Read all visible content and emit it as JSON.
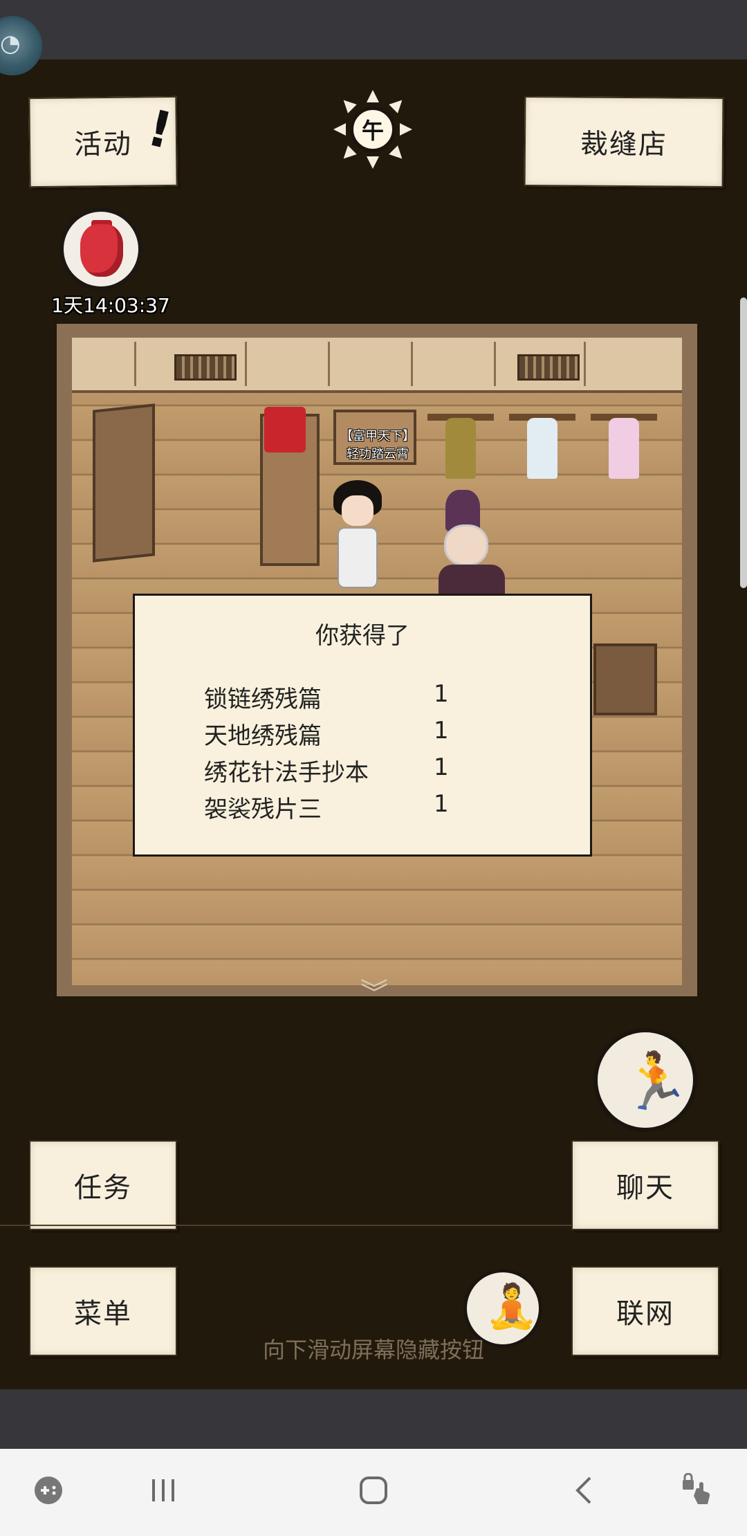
{
  "top_buttons": {
    "activity_label": "活动",
    "activity_alert": "!",
    "shop_label": "裁缝店"
  },
  "time_of_day": {
    "char": "午"
  },
  "redbag": {
    "timer": "1天14:03:37"
  },
  "scene": {
    "shop_sign_line1": "【富甲天下】",
    "shop_sign_line2": "轻功踏云霄"
  },
  "dialog": {
    "title": "你获得了",
    "items": [
      {
        "name": "锁链绣残篇",
        "qty": "1"
      },
      {
        "name": "天地绣残篇",
        "qty": "1"
      },
      {
        "name": "绣花针法手抄本",
        "qty": "1"
      },
      {
        "name": "袈裟残片三",
        "qty": "1"
      }
    ]
  },
  "bottom_buttons": {
    "task_label": "任务",
    "chat_label": "聊天",
    "menu_label": "菜单",
    "network_label": "联网"
  },
  "hint_text": "向下滑动屏幕隐藏按钮",
  "icons": {
    "float": "assistant-icon",
    "run": "running-icon",
    "meditate": "meditation-icon",
    "nav": [
      "game-launcher-icon",
      "recent-apps-icon",
      "home-icon",
      "back-icon",
      "touch-lock-icon"
    ]
  },
  "colors": {
    "background": "#21190b",
    "paper": "#f8f0dd",
    "status_bar": "#37363a",
    "nav_bar": "#f4f4f4"
  }
}
